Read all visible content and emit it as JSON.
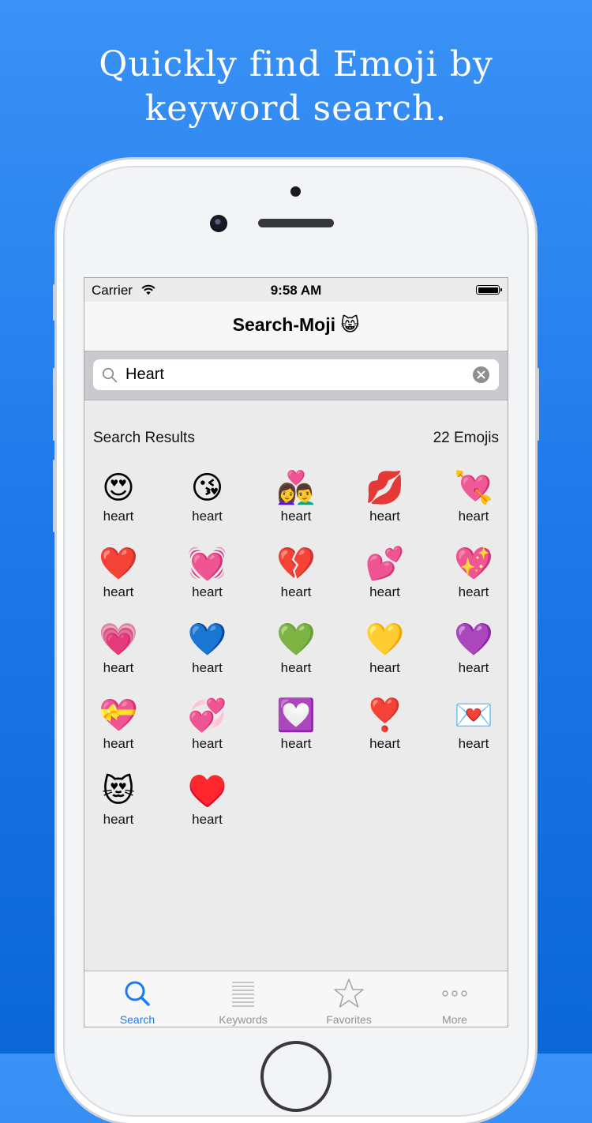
{
  "headline": {
    "line1": "Quickly find Emoji by",
    "line2": "keyword search."
  },
  "status_bar": {
    "carrier": "Carrier",
    "time": "9:58 AM"
  },
  "nav": {
    "title": "Search-Moji 😸"
  },
  "search": {
    "value": "Heart"
  },
  "results": {
    "title": "Search Results",
    "count": "22 Emojis",
    "items": [
      {
        "emoji": "😍",
        "label": "heart"
      },
      {
        "emoji": "😘",
        "label": "heart"
      },
      {
        "emoji": "👩‍❤️‍👨",
        "label": "heart"
      },
      {
        "emoji": "💋",
        "label": "heart"
      },
      {
        "emoji": "💘",
        "label": "heart"
      },
      {
        "emoji": "❤️",
        "label": "heart"
      },
      {
        "emoji": "💓",
        "label": "heart"
      },
      {
        "emoji": "💔",
        "label": "heart"
      },
      {
        "emoji": "💕",
        "label": "heart"
      },
      {
        "emoji": "💖",
        "label": "heart"
      },
      {
        "emoji": "💗",
        "label": "heart"
      },
      {
        "emoji": "💙",
        "label": "heart"
      },
      {
        "emoji": "💚",
        "label": "heart"
      },
      {
        "emoji": "💛",
        "label": "heart"
      },
      {
        "emoji": "💜",
        "label": "heart"
      },
      {
        "emoji": "💝",
        "label": "heart"
      },
      {
        "emoji": "💞",
        "label": "heart"
      },
      {
        "emoji": "💟",
        "label": "heart"
      },
      {
        "emoji": "❣️",
        "label": "heart"
      },
      {
        "emoji": "💌",
        "label": "heart"
      },
      {
        "emoji": "😻",
        "label": "heart"
      },
      {
        "emoji": "♥️",
        "label": "heart"
      }
    ]
  },
  "tabs": [
    {
      "label": "Search",
      "icon": "search-icon",
      "active": true
    },
    {
      "label": "Keywords",
      "icon": "list-icon",
      "active": false
    },
    {
      "label": "Favorites",
      "icon": "star-icon",
      "active": false
    },
    {
      "label": "More",
      "icon": "more-icon",
      "active": false
    }
  ],
  "colors": {
    "accent": "#1a7cf0",
    "background": "#2a84f0",
    "inactive": "#929292"
  }
}
